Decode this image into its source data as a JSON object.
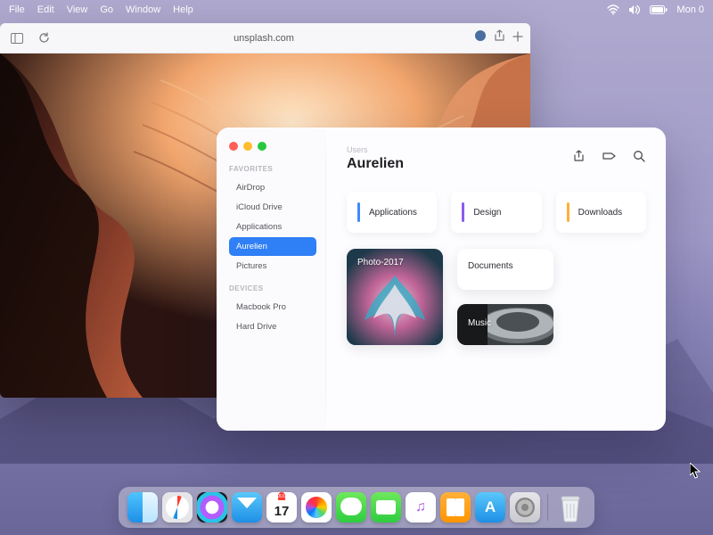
{
  "menubar": {
    "items": [
      "File",
      "Edit",
      "View",
      "Go",
      "Window",
      "Help"
    ],
    "clock": "Mon 0"
  },
  "safari": {
    "url": "unsplash.com"
  },
  "finder": {
    "breadcrumb": "Users",
    "title": "Aurelien",
    "sidebar": {
      "favorites_heading": "FAVORITES",
      "favorites": [
        "AirDrop",
        "iCloud Drive",
        "Applications",
        "Aurelien",
        "Pictures"
      ],
      "devices_heading": "DEVICES",
      "devices": [
        "Macbook Pro",
        "Hard Drive"
      ]
    },
    "folders": {
      "applications": "Applications",
      "design": "Design",
      "downloads": "Downloads"
    },
    "tiles": {
      "photo": "Photo-2017",
      "documents": "Documents",
      "music": "Music"
    }
  },
  "dock": {
    "calendar_month": "JUL",
    "calendar_day": "17",
    "apps": [
      "Finder",
      "Safari",
      "Siri",
      "Mail",
      "Calendar",
      "Photos",
      "Messages",
      "FaceTime",
      "iTunes",
      "iBooks",
      "App Store",
      "System Preferences",
      "Trash"
    ]
  }
}
